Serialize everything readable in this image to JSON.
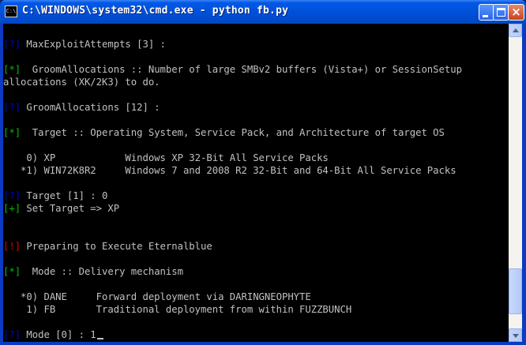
{
  "window": {
    "title": "C:\\WINDOWS\\system32\\cmd.exe - python fb.py",
    "icon": "cmd-icon",
    "icon_text": "C:\\",
    "buttons": {
      "minimize": "minimize-icon",
      "maximize": "maximize-icon",
      "close_glyph": "×"
    }
  },
  "console": {
    "lines": [
      {
        "tag": "",
        "text": ""
      },
      {
        "tag": "[?]",
        "tag_type": "q",
        "text": " MaxExploitAttempts [3] :"
      },
      {
        "tag": "",
        "text": ""
      },
      {
        "tag": "[*]",
        "tag_type": "ok",
        "text": "  GroomAllocations :: Number of large SMBv2 buffers (Vista+) or SessionSetup"
      },
      {
        "tag": "",
        "text": "allocations (XK/2K3) to do."
      },
      {
        "tag": "",
        "text": ""
      },
      {
        "tag": "[?]",
        "tag_type": "q",
        "text": " GroomAllocations [12] :"
      },
      {
        "tag": "",
        "text": ""
      },
      {
        "tag": "[*]",
        "tag_type": "ok",
        "text": "  Target :: Operating System, Service Pack, and Architecture of target OS"
      },
      {
        "tag": "",
        "text": ""
      },
      {
        "tag": "",
        "text": "    0) XP            Windows XP 32-Bit All Service Packs"
      },
      {
        "tag": "",
        "text": "   *1) WIN72K8R2     Windows 7 and 2008 R2 32-Bit and 64-Bit All Service Packs"
      },
      {
        "tag": "",
        "text": ""
      },
      {
        "tag": "[?]",
        "tag_type": "q",
        "text": " Target [1] : 0"
      },
      {
        "tag": "[+]",
        "tag_type": "ok",
        "text": " Set Target => XP"
      },
      {
        "tag": "",
        "text": ""
      },
      {
        "tag": "",
        "text": ""
      },
      {
        "tag": "[!]",
        "tag_type": "err",
        "text": " Preparing to Execute Eternalblue"
      },
      {
        "tag": "",
        "text": ""
      },
      {
        "tag": "[*]",
        "tag_type": "ok",
        "text": "  Mode :: Delivery mechanism"
      },
      {
        "tag": "",
        "text": ""
      },
      {
        "tag": "",
        "text": "   *0) DANE     Forward deployment via DARINGNEOPHYTE"
      },
      {
        "tag": "",
        "text": "    1) FB       Traditional deployment from within FUZZBUNCH"
      },
      {
        "tag": "",
        "text": ""
      },
      {
        "tag": "[?]",
        "tag_type": "q",
        "text": " Mode [0] : 1",
        "cursor": true
      }
    ]
  },
  "colors": {
    "console_bg": "#000000",
    "console_text": "#c0c0c0",
    "tag_question": "#0000d8",
    "tag_info": "#00c000",
    "tag_warning": "#e00000",
    "titlebar": "#0050d8"
  },
  "scrollbar": {
    "position_fraction": 0.77
  }
}
